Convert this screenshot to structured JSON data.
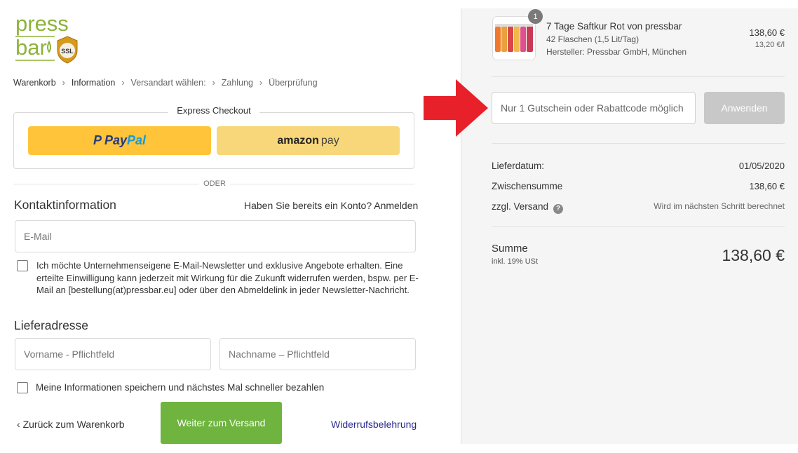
{
  "brand": {
    "logo_line1": "press",
    "logo_line2": "bar",
    "ssl_badge": "SSL",
    "logo_color": "#8db33a"
  },
  "breadcrumb": [
    "Warenkorb",
    "Information",
    "Versandart wählen:",
    "Zahlung",
    "Überprüfung"
  ],
  "express": {
    "label": "Express Checkout",
    "paypal_part1": "Pay",
    "paypal_part2": "Pal",
    "paypal_icon": "P",
    "amazon_part1": "amazon",
    "amazon_part2": "pay",
    "divider_label": "ODER"
  },
  "contact": {
    "heading": "Kontaktinformation",
    "login_prompt": "Haben Sie bereits ein Konto?",
    "login_link": "Anmelden",
    "email_placeholder": "E-Mail",
    "newsletter_consent": "Ich möchte Unternehmenseigene E-Mail-Newsletter und exklusive Angebote erhalten. Eine erteilte Einwilligung kann jederzeit mit Wirkung für die Zukunft widerrufen werden, bspw. per E-Mail an [bestellung(at)pressbar.eu] oder über den Abmeldelink in jeder Newsletter-Nachricht."
  },
  "address": {
    "heading": "Lieferadresse",
    "firstname_placeholder": "Vorname - Pflichtfeld",
    "lastname_placeholder": "Nachname – Pflichtfeld",
    "save_info": "Meine Informationen speichern und nächstes Mal schneller bezahlen"
  },
  "footer": {
    "back_label": "Zurück zum Warenkorb",
    "continue_label": "Weiter zum Versand",
    "withdraw_label": "Widerrufsbelehrung"
  },
  "order": {
    "quantity": "1",
    "product_title": "7 Tage Saftkur Rot von pressbar",
    "product_detail": "42 Flaschen (1,5 Lit/Tag)",
    "product_maker": "Hersteller: Pressbar GmbH, München",
    "product_price": "138,60 €",
    "unit_price": "13,20 €/l",
    "coupon_placeholder": "Nur 1 Gutschein oder Rabattcode möglich",
    "apply_label": "Anwenden",
    "delivery_label": "Lieferdatum:",
    "delivery_value": "01/05/2020",
    "subtotal_label": "Zwischensumme",
    "subtotal_value": "138,60 €",
    "shipping_label": "zzgl. Versand",
    "shipping_value": "Wird im nächsten Schritt berechnet",
    "total_label": "Summe",
    "total_sub": "inkl. 19% USt",
    "total_value": "138,60 €"
  },
  "colors": {
    "paypal_yellow": "#ffc43a",
    "amazon_yellow": "#f8d77a",
    "continue_green": "#6eb43f",
    "arrow_red": "#e8202a",
    "apply_grey": "#c8c8c8"
  },
  "icons": {
    "help": "question-circle-icon",
    "back": "chevron-left-icon",
    "breadcrumb_sep": "chevron-right-icon"
  }
}
